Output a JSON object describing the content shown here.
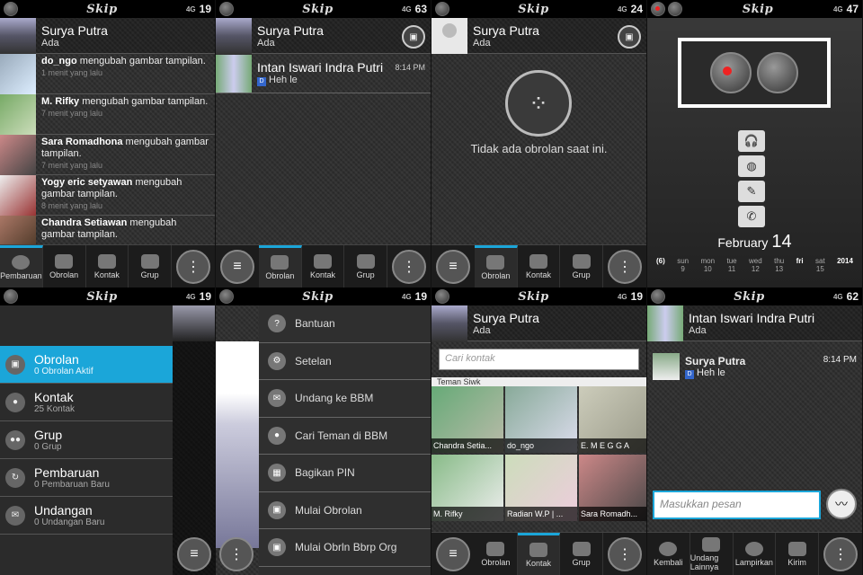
{
  "brand": "Skip",
  "panels": {
    "p1": {
      "status_num": "19",
      "status_net": "4G",
      "profile": {
        "name": "Surya Putra",
        "status": "Ada"
      },
      "updates": [
        {
          "name": "do_ngo",
          "text": "mengubah gambar tampilan.",
          "time": "1 menit yang lalu"
        },
        {
          "name": "M. Rifky",
          "text": "mengubah gambar tampilan.",
          "time": "7 menit yang lalu"
        },
        {
          "name": "Sara Romadhona",
          "text": "mengubah gambar tampilan.",
          "time": "7 menit yang lalu"
        },
        {
          "name": "Yogy eric setyawan",
          "text": "mengubah gambar tampilan.",
          "time": "8 menit yang lalu"
        },
        {
          "name": "Chandra Setiawan",
          "text": "mengubah gambar tampilan.",
          "time": ""
        }
      ],
      "toolbar": [
        "Pembaruan",
        "Obrolan",
        "Kontak",
        "Grup"
      ]
    },
    "p2": {
      "status_num": "63",
      "status_net": "4G",
      "profile": {
        "name": "Surya Putra",
        "status": "Ada"
      },
      "chat": {
        "name": "Intan Iswari Indra Putri",
        "time": "8:14 PM",
        "msg": "Heh le"
      },
      "toolbar": [
        "Obrolan",
        "Kontak",
        "Grup"
      ]
    },
    "p3": {
      "status_num": "24",
      "status_net": "4G",
      "profile": {
        "name": "Surya Putra",
        "status": "Ada"
      },
      "empty": "Tidak ada obrolan saat ini.",
      "toolbar": [
        "Obrolan",
        "Kontak",
        "Grup"
      ]
    },
    "p4": {
      "status_num": "47",
      "status_net": "4G",
      "month": "February",
      "day": "14",
      "days": [
        {
          "d": "(6)",
          "n": ""
        },
        {
          "d": "sun",
          "n": "9"
        },
        {
          "d": "mon",
          "n": "10"
        },
        {
          "d": "tue",
          "n": "11"
        },
        {
          "d": "wed",
          "n": "12"
        },
        {
          "d": "thu",
          "n": "13"
        },
        {
          "d": "fri",
          "n": ""
        },
        {
          "d": "sat",
          "n": "15"
        },
        {
          "d": "2014",
          "n": ""
        }
      ]
    },
    "p5": {
      "status_num": "19",
      "status_net": "4G",
      "items": [
        {
          "title": "Obrolan",
          "sub": "0 Obrolan Aktif"
        },
        {
          "title": "Kontak",
          "sub": "25 Kontak"
        },
        {
          "title": "Grup",
          "sub": "0 Grup"
        },
        {
          "title": "Pembaruan",
          "sub": "0 Pembaruan Baru"
        },
        {
          "title": "Undangan",
          "sub": "0 Undangan Baru"
        }
      ]
    },
    "p6": {
      "status_num": "19",
      "status_net": "4G",
      "menu": [
        "Bantuan",
        "Setelan",
        "Undang ke BBM",
        "Cari Teman di BBM",
        "Bagikan PIN",
        "Mulai Obrolan",
        "Mulai Obrln Bbrp Org"
      ]
    },
    "p7": {
      "status_num": "19",
      "status_net": "4G",
      "profile": {
        "name": "Surya Putra",
        "status": "Ada"
      },
      "search_placeholder": "Cari kontak",
      "group_label": "Teman Siwk",
      "contacts": [
        "Chandra Setia...",
        "do_ngo",
        "E. M E G G A",
        "M. Rifky",
        "Radian W.P | ...",
        "Sara Romadh..."
      ],
      "toolbar": [
        "Obrolan",
        "Kontak",
        "Grup"
      ]
    },
    "p8": {
      "status_num": "62",
      "status_net": "4G",
      "header": {
        "name": "Intan Iswari Indra Putri",
        "status": "Ada"
      },
      "message": {
        "name": "Surya Putra",
        "time": "8:14 PM",
        "msg": "Heh le"
      },
      "input_placeholder": "Masukkan pesan",
      "toolbar": [
        "Kembali",
        "Undang Lainnya",
        "Lampirkan",
        "Kirim"
      ]
    }
  }
}
